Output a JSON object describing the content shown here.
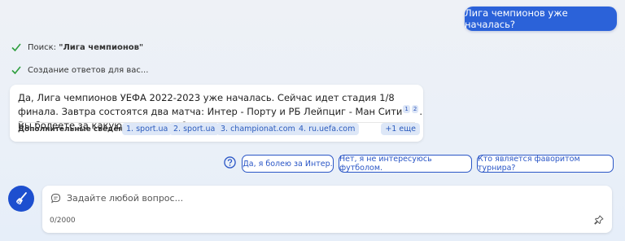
{
  "user_message": "Лига чемпионов уже началась?",
  "status": {
    "search_prefix": "Поиск: ",
    "search_query": "\"Лига чемпионов\"",
    "generating": "Создание ответов для вас..."
  },
  "answer": {
    "text_part1": "Да, Лига чемпионов УЕФА 2022-2023 уже началась. Сейчас идет стадия 1/8 финала. Завтра состоятся два матча: Интер - Порту и РБ Лейпциг - Ман Сити",
    "citations": [
      "1",
      "2"
    ],
    "text_part2": ". Вы болеете за какую-то команду?",
    "sources_label": "Дополнительные сведения:",
    "sources": [
      "1. sport.ua",
      "2. sport.ua",
      "3. championat.com",
      "4. ru.uefa.com"
    ],
    "more_label": "+1 еще"
  },
  "suggestions": [
    "Да, я болею за Интер.",
    "Нет, я не интересуюсь футболом.",
    "Кто является фаворитом турнира?"
  ],
  "input": {
    "placeholder": "Задайте любой вопрос...",
    "counter": "0/2000"
  },
  "colors": {
    "accent": "#2b62d9",
    "chip_bg": "#dde7f7",
    "check": "#2e9e3e"
  },
  "icons": [
    "checkmark-icon",
    "question-icon",
    "broom-icon",
    "chat-icon",
    "pin-icon"
  ]
}
